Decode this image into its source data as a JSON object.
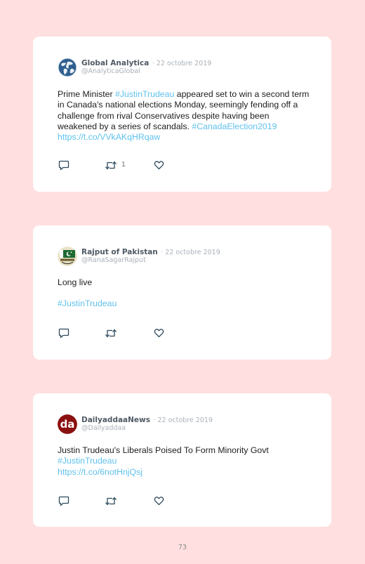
{
  "tweets": [
    {
      "author": "Global Analytica",
      "date": "· 22 octobre 2019",
      "handle": "@AnalyticaGlobal",
      "avatar_icon": "globe-icon",
      "text_parts": {
        "p1": "Prime Minister ",
        "l1": "#JustinTrudeau",
        "p2": " appeared set to win a second term in Canada's national elections Monday, seemingly fending off a challenge from rival Conservatives despite having been weakened by a series of scandals. ",
        "l2": "#CanadaElection2019",
        "l3": "https://t.co/VVkAKqHRqaw"
      },
      "retweets": "1"
    },
    {
      "author": "Rajput of Pakistan",
      "date": "· 22 octobre 2019",
      "handle": "@RanaSagarRajput",
      "avatar_icon": "pakistan-flag-emblem-icon",
      "text_parts": {
        "p1": "Long live",
        "l1": "#JustinTrudeau"
      }
    },
    {
      "author": "DailyaddaaNews",
      "date": "· 22 octobre 2019",
      "handle": "@Dailyaddaa",
      "avatar_icon": "da-logo-icon",
      "avatar_logo_text": "da",
      "text_parts": {
        "p1": "Justin Trudeau's Liberals Poised To Form Minority Govt",
        "l1": "#JustinTrudeau",
        "l2": "https://t.co/6notHnjQsj"
      }
    }
  ],
  "icons": {
    "reply": "reply-icon",
    "retweet": "retweet-icon",
    "like": "heart-icon"
  },
  "colors": {
    "background": "#ffdfe0",
    "card": "#ffffff",
    "link": "#5ec1ec",
    "author": "#4f5a64",
    "muted": "#a9b1b9"
  },
  "page_number": "73"
}
